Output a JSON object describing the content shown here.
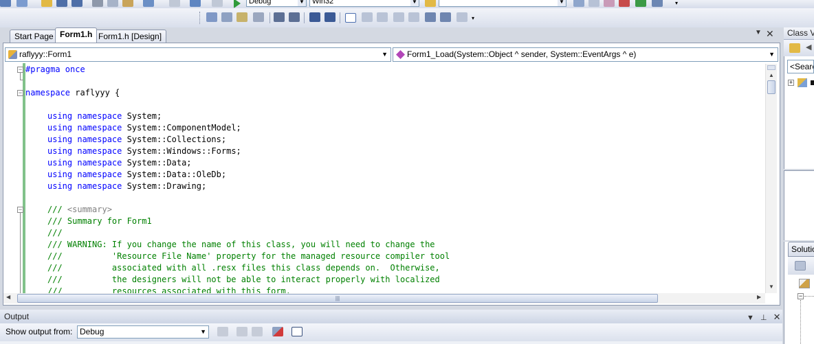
{
  "toolbar": {
    "configuration": "Debug",
    "platform": "Win32",
    "find_value": ""
  },
  "tabs": [
    {
      "label": "Start Page",
      "active": false
    },
    {
      "label": "Form1.h",
      "active": true
    },
    {
      "label": "Form1.h [Design]",
      "active": false
    }
  ],
  "navbar": {
    "class_combo": "raflyyy::Form1",
    "member_combo": "Form1_Load(System::Object ^ sender, System::EventArgs ^ e)"
  },
  "code_lines": [
    {
      "type": "pp",
      "text": "#pragma once"
    },
    {
      "type": "blank",
      "text": ""
    },
    {
      "type": "ns",
      "kw": "namespace",
      "rest": " raflyyy {"
    },
    {
      "type": "blank",
      "text": ""
    },
    {
      "type": "using",
      "rest": " System;"
    },
    {
      "type": "using",
      "rest": " System::ComponentModel;"
    },
    {
      "type": "using",
      "rest": " System::Collections;"
    },
    {
      "type": "using",
      "rest": " System::Windows::Forms;"
    },
    {
      "type": "using",
      "rest": " System::Data;"
    },
    {
      "type": "using",
      "rest": " System::Data::OleDb;"
    },
    {
      "type": "using",
      "rest": " System::Drawing;"
    },
    {
      "type": "blank",
      "text": ""
    },
    {
      "type": "summary",
      "prefix": "/// ",
      "tag": "<summary>"
    },
    {
      "type": "comment",
      "text": "/// Summary for Form1"
    },
    {
      "type": "comment",
      "text": "///"
    },
    {
      "type": "comment",
      "text": "/// WARNING: If you change the name of this class, you will need to change the"
    },
    {
      "type": "comment",
      "text": "///          'Resource File Name' property for the managed resource compiler tool"
    },
    {
      "type": "comment",
      "text": "///          associated with all .resx files this class depends on.  Otherwise,"
    },
    {
      "type": "comment",
      "text": "///          the designers will not be able to interact properly with localized"
    },
    {
      "type": "comment",
      "text": "///          resources associated with this form."
    }
  ],
  "keywords": {
    "using": "using",
    "namespace": "namespace"
  },
  "class_view": {
    "title": "Class Vi",
    "search_placeholder": "<Searc"
  },
  "solution_explorer": {
    "title": "Solutio"
  },
  "output": {
    "title": "Output",
    "show_from_label": "Show output from:",
    "source": "Debug"
  },
  "colors": {
    "keyword": "#0000ff",
    "comment": "#008000",
    "xml_tag": "#808080",
    "changed_bar": "#1a8f2a"
  }
}
